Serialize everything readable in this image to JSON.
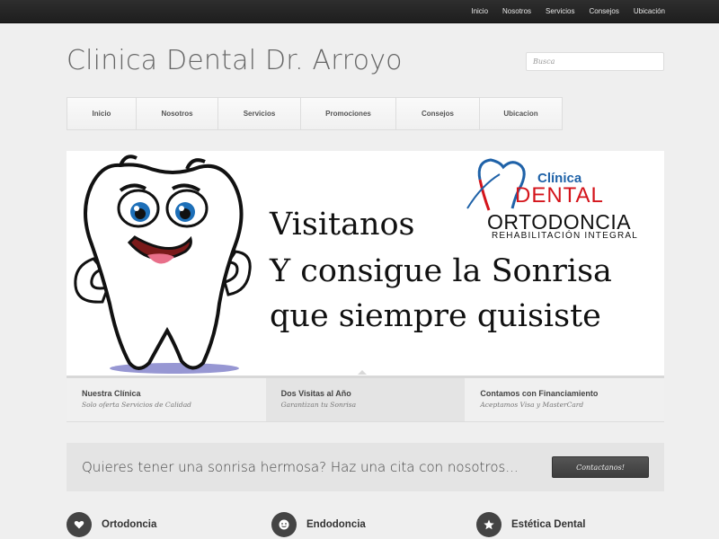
{
  "topnav": [
    "Inicio",
    "Nosotros",
    "Servicios",
    "Consejos",
    "Ubicación"
  ],
  "site_title": "Clinica Dental Dr. Arroyo",
  "search": {
    "placeholder": "Busca"
  },
  "mainnav": [
    "Inicio",
    "Nosotros",
    "Servicios",
    "Promociones",
    "Consejos",
    "Ubicacion"
  ],
  "slide": {
    "line1": "Visitanos",
    "line2": "Y consigue la Sonrisa",
    "line3": "que siempre quisiste",
    "logo": {
      "clinica": "Clínica",
      "dental": "DENTAL",
      "ortodoncia": "ORTODONCIA",
      "rehab": "REHABILITACIÓN INTEGRAL"
    }
  },
  "slide_tabs": [
    {
      "title": "Nuestra Clínica",
      "subtitle": "Solo oferta Servicios de Calidad",
      "active": false
    },
    {
      "title": "Dos Visitas al Año",
      "subtitle": "Garantizan tu Sonrisa",
      "active": true
    },
    {
      "title": "Contamos con Financiamiento",
      "subtitle": "Aceptamos Visa y MasterCard",
      "active": false
    }
  ],
  "cta": {
    "text": "Quieres tener una sonrisa hermosa? Haz una cita con nosotros...",
    "button": "Contactanos!"
  },
  "services": [
    {
      "label": "Ortodoncia",
      "icon": "heart-icon"
    },
    {
      "label": "Endodoncia",
      "icon": "smiley-icon"
    },
    {
      "label": "Estética Dental",
      "icon": "star-icon"
    }
  ],
  "colors": {
    "topbar": "#262626",
    "background": "#efefef",
    "logo_blue": "#1f62a8",
    "logo_red": "#d4141b",
    "cta_button": "#444444"
  }
}
